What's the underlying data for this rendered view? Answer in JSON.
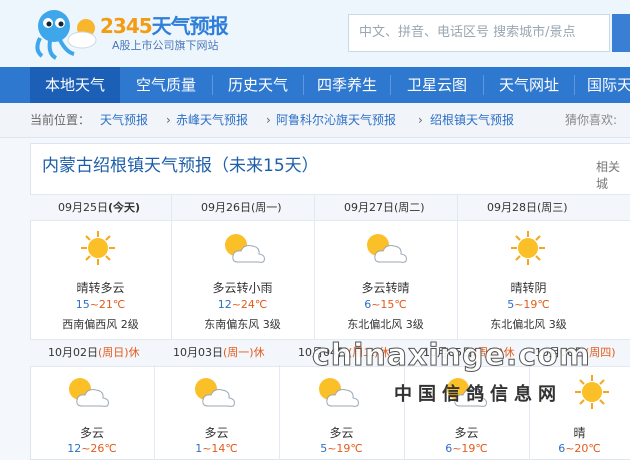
{
  "header": {
    "brand_num": "2345",
    "brand_text": "天气预报",
    "tagline": "A股上市公司旗下网站",
    "search_placeholder": "中文、拼音、电话区号  搜索城市/景点"
  },
  "nav": [
    "本地天气",
    "空气质量",
    "历史天气",
    "四季养生",
    "卫星云图",
    "天气网址",
    "国际天"
  ],
  "breadcrumb": {
    "prefix": "当前位置：",
    "items": [
      "天气预报",
      "赤峰天气预报",
      "阿鲁科尔沁旗天气预报",
      "绍根镇天气预报"
    ],
    "right": "猜你喜欢:"
  },
  "title": "内蒙古绍根镇天气预报（未来15天）",
  "related": "相关城",
  "row1": [
    {
      "date": "09月25日",
      "weekday": "(今天)",
      "icon": "sunny-icon",
      "cond": "晴转多云",
      "lo": "15",
      "hi": "~21℃",
      "wind": "西南偏西风  2级"
    },
    {
      "date": "09月26日",
      "weekday": "(周一)",
      "icon": "partly-cloudy-icon",
      "cond": "多云转小雨",
      "lo": "12",
      "hi": "~24℃",
      "wind": "东南偏东风  3级"
    },
    {
      "date": "09月27日",
      "weekday": "(周二)",
      "icon": "partly-cloudy-icon",
      "cond": "多云转晴",
      "lo": "6",
      "hi": "~15℃",
      "wind": "东北偏北风  3级"
    },
    {
      "date": "09月28日",
      "weekday": "(周三)",
      "icon": "sunny-icon",
      "cond": "晴转阴",
      "lo": "5",
      "hi": "~19℃",
      "wind": "东北偏北风  3级"
    }
  ],
  "row2": [
    {
      "date": "10月02日",
      "weekday": "(周日)",
      "holiday": "休",
      "cond": "多云",
      "lo": "12",
      "hi": "~26℃"
    },
    {
      "date": "10月03日",
      "weekday": "(周一)",
      "holiday": "休",
      "cond": "多云",
      "lo": "1",
      "hi": "~14℃"
    },
    {
      "date": "10月04日",
      "weekday": "(周二)",
      "holiday": "休",
      "cond": "多云",
      "lo": "5",
      "hi": "~19℃"
    },
    {
      "date": "10月05日",
      "weekday": "(周三)",
      "holiday": "休",
      "cond": "多云",
      "lo": "6",
      "hi": "~19℃"
    },
    {
      "date": "10月06日",
      "weekday": "(周四)",
      "holiday": "",
      "cond": "晴",
      "lo": "6",
      "hi": "~20℃"
    }
  ],
  "watermark": {
    "line1": "chinaxinge.com",
    "line2": "中国信鸽信息网"
  },
  "colors": {
    "nav": "#2f78cf",
    "nav_active": "#1b5fb6",
    "link": "#2d6fc4",
    "temp_high": "#e35b1b"
  }
}
